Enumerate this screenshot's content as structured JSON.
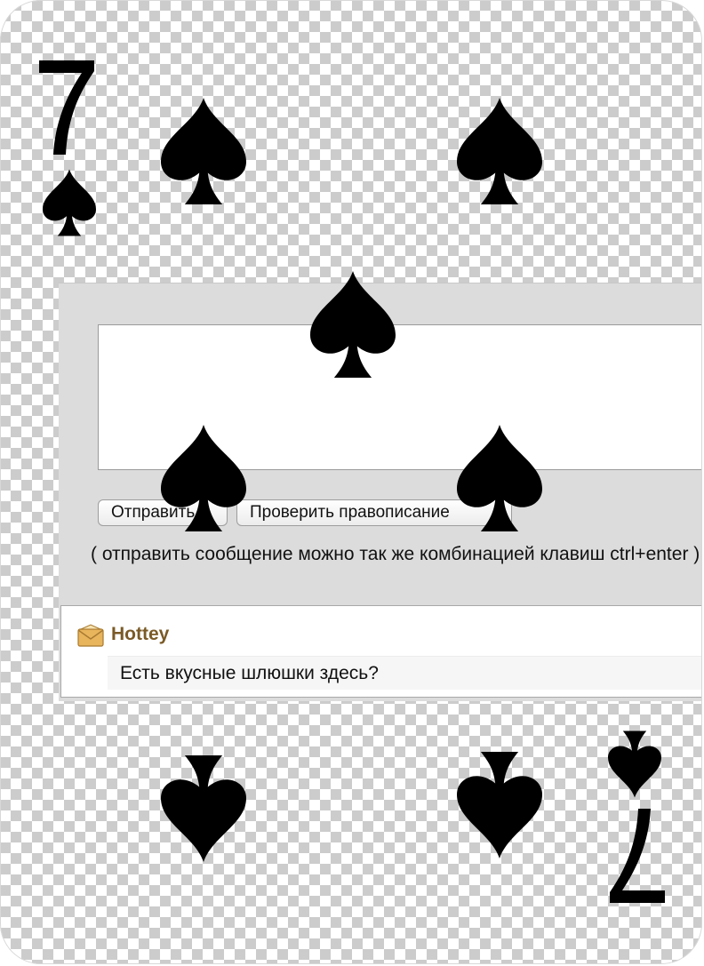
{
  "card": {
    "rank": "7",
    "suit": "spades",
    "suit_icon": "spade-icon",
    "ink_color": "#000000"
  },
  "form": {
    "send_button_label": "Отправить",
    "spellcheck_button_label": "Проверить правописание",
    "hint_text": "( отправить сообщение можно так же комбинацией клавиш ctrl+enter )",
    "message_value": ""
  },
  "message": {
    "icon": "envelope-icon",
    "author": "Hottey",
    "text": "Есть вкусные шлюшки здесь?"
  }
}
